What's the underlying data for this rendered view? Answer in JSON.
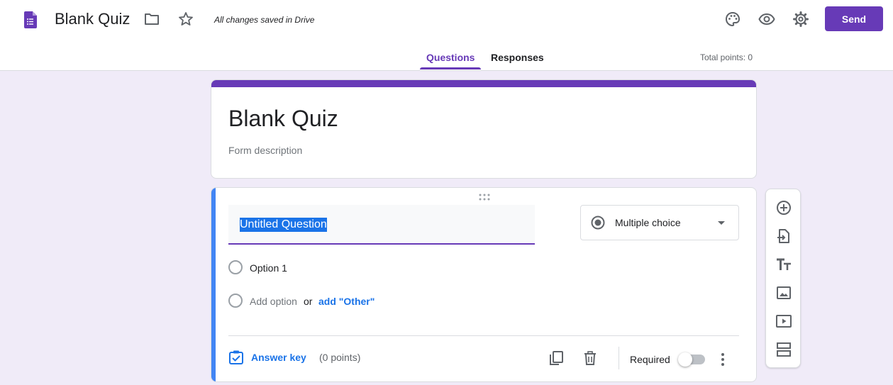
{
  "header": {
    "title": "Blank Quiz",
    "saved_status": "All changes saved in Drive",
    "send_label": "Send",
    "icons": [
      "forms-icon",
      "folder-icon",
      "star-icon",
      "palette-icon",
      "preview-icon",
      "settings-icon"
    ]
  },
  "tabs": [
    {
      "label": "Questions",
      "active": true
    },
    {
      "label": "Responses",
      "active": false
    }
  ],
  "total_points": "Total points: 0",
  "form": {
    "title": "Blank Quiz",
    "description_placeholder": "Form description"
  },
  "question": {
    "title": "Untitled Question",
    "type": "Multiple choice",
    "options": [
      "Option 1"
    ],
    "add_option": "Add option",
    "or": "or",
    "add_other": "add \"Other\"",
    "answer_key": "Answer key",
    "points": "(0 points)",
    "required_label": "Required",
    "required": false
  },
  "side_toolbar": [
    "add-question-icon",
    "import-questions-icon",
    "add-title-icon",
    "add-image-icon",
    "add-video-icon",
    "add-section-icon"
  ],
  "colors": {
    "accent": "#673ab7",
    "background": "#f0ebf8",
    "link": "#1a73e8",
    "active_card_bar": "#4285f4"
  }
}
